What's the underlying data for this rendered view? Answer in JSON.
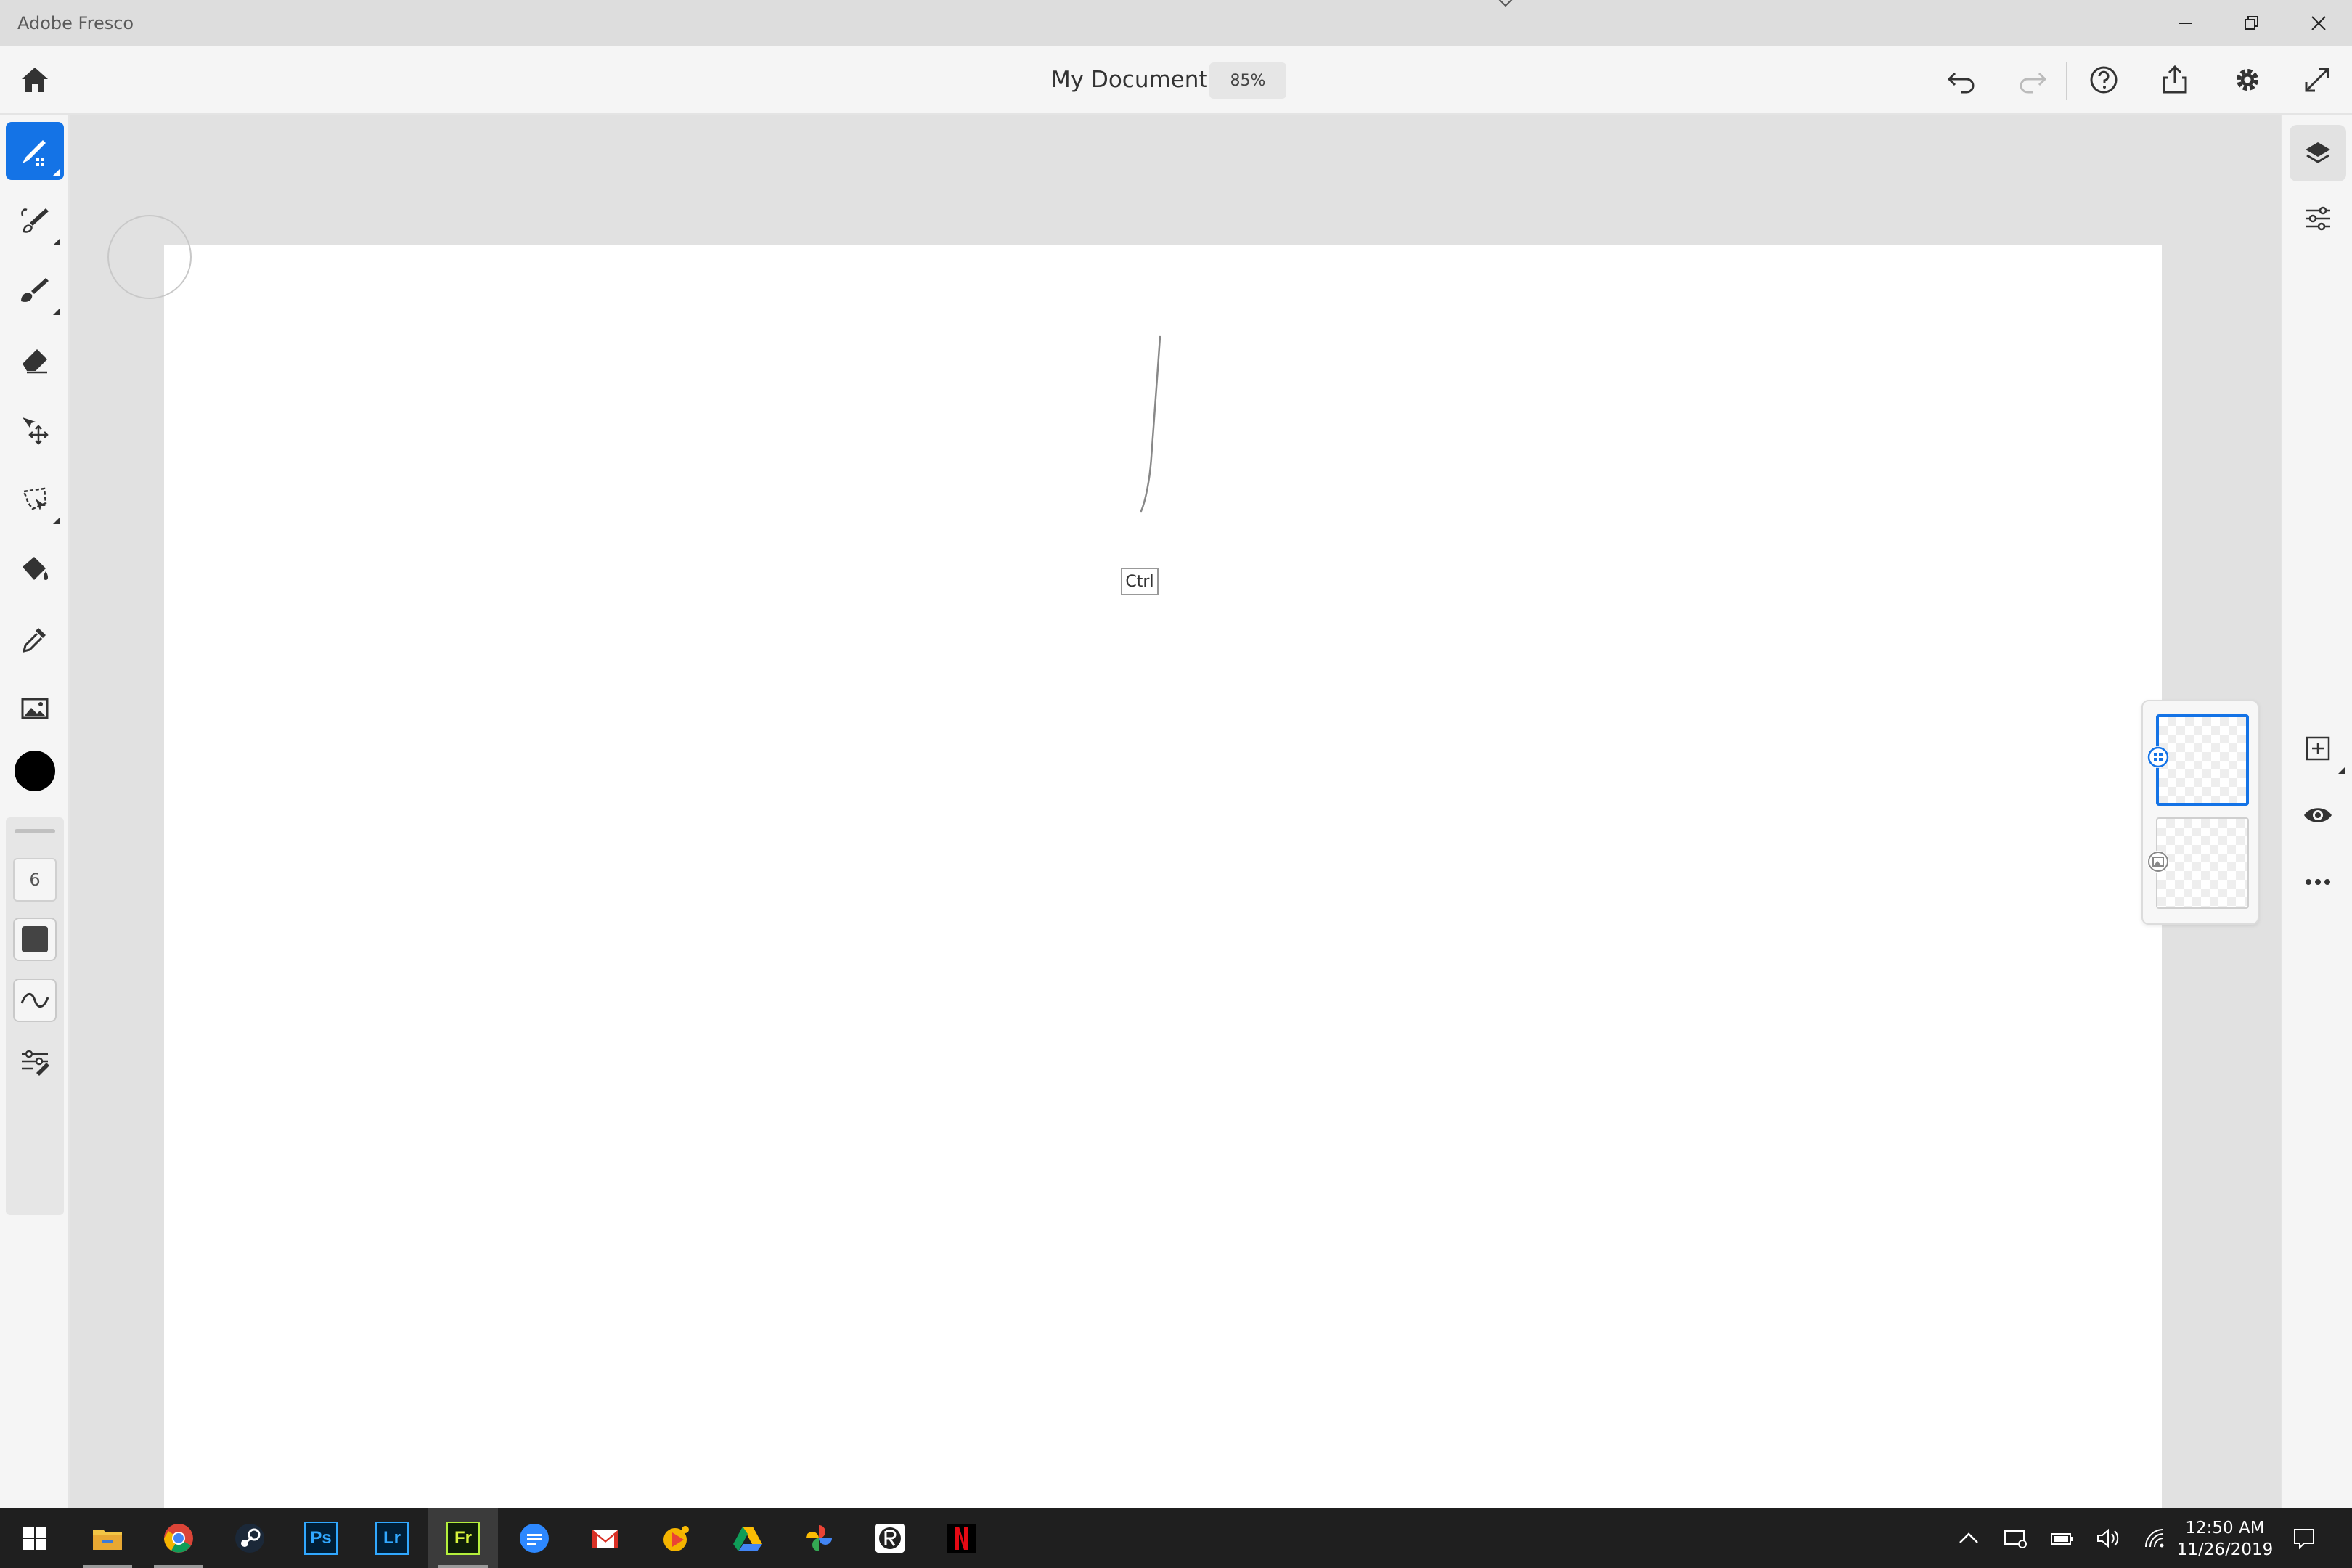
{
  "window": {
    "title": "Adobe Fresco"
  },
  "toolbar": {
    "document_title": "My Document",
    "zoom": "85%",
    "icons": [
      "home-icon",
      "undo-icon",
      "redo-icon",
      "help-icon",
      "share-icon",
      "settings-icon",
      "fullscreen-icon"
    ]
  },
  "tools": {
    "items": [
      "pixel-brush",
      "live-brush",
      "vector-brush",
      "eraser",
      "transform",
      "selection",
      "fill",
      "eyedropper",
      "place-image"
    ],
    "active": "pixel-brush",
    "color": "#000000"
  },
  "brush_properties": {
    "size": "6"
  },
  "canvas": {
    "key_hint": "Ctrl"
  },
  "right_panel": {
    "icons": [
      "layers-icon",
      "adjustments-icon",
      "add-layer-icon",
      "visibility-icon",
      "more-icon"
    ]
  },
  "layers": {
    "count": 2,
    "selected_index": 0
  },
  "taskbar": {
    "apps": [
      "file-explorer",
      "chrome",
      "steam",
      "photoshop",
      "lightroom",
      "fresco",
      "messenger",
      "gmail",
      "slides",
      "google-drive",
      "photos",
      "app-r",
      "netflix"
    ],
    "ps_label": "Ps",
    "lr_label": "Lr",
    "fr_label": "Fr",
    "time": "12:50 AM",
    "date": "11/26/2019"
  },
  "colors": {
    "accent": "#1473e6",
    "toolbar_bg": "#f5f5f5",
    "canvas_bg": "#ffffff",
    "workspace_bg": "#e1e1e1",
    "taskbar_bg": "#1f1f1f"
  }
}
